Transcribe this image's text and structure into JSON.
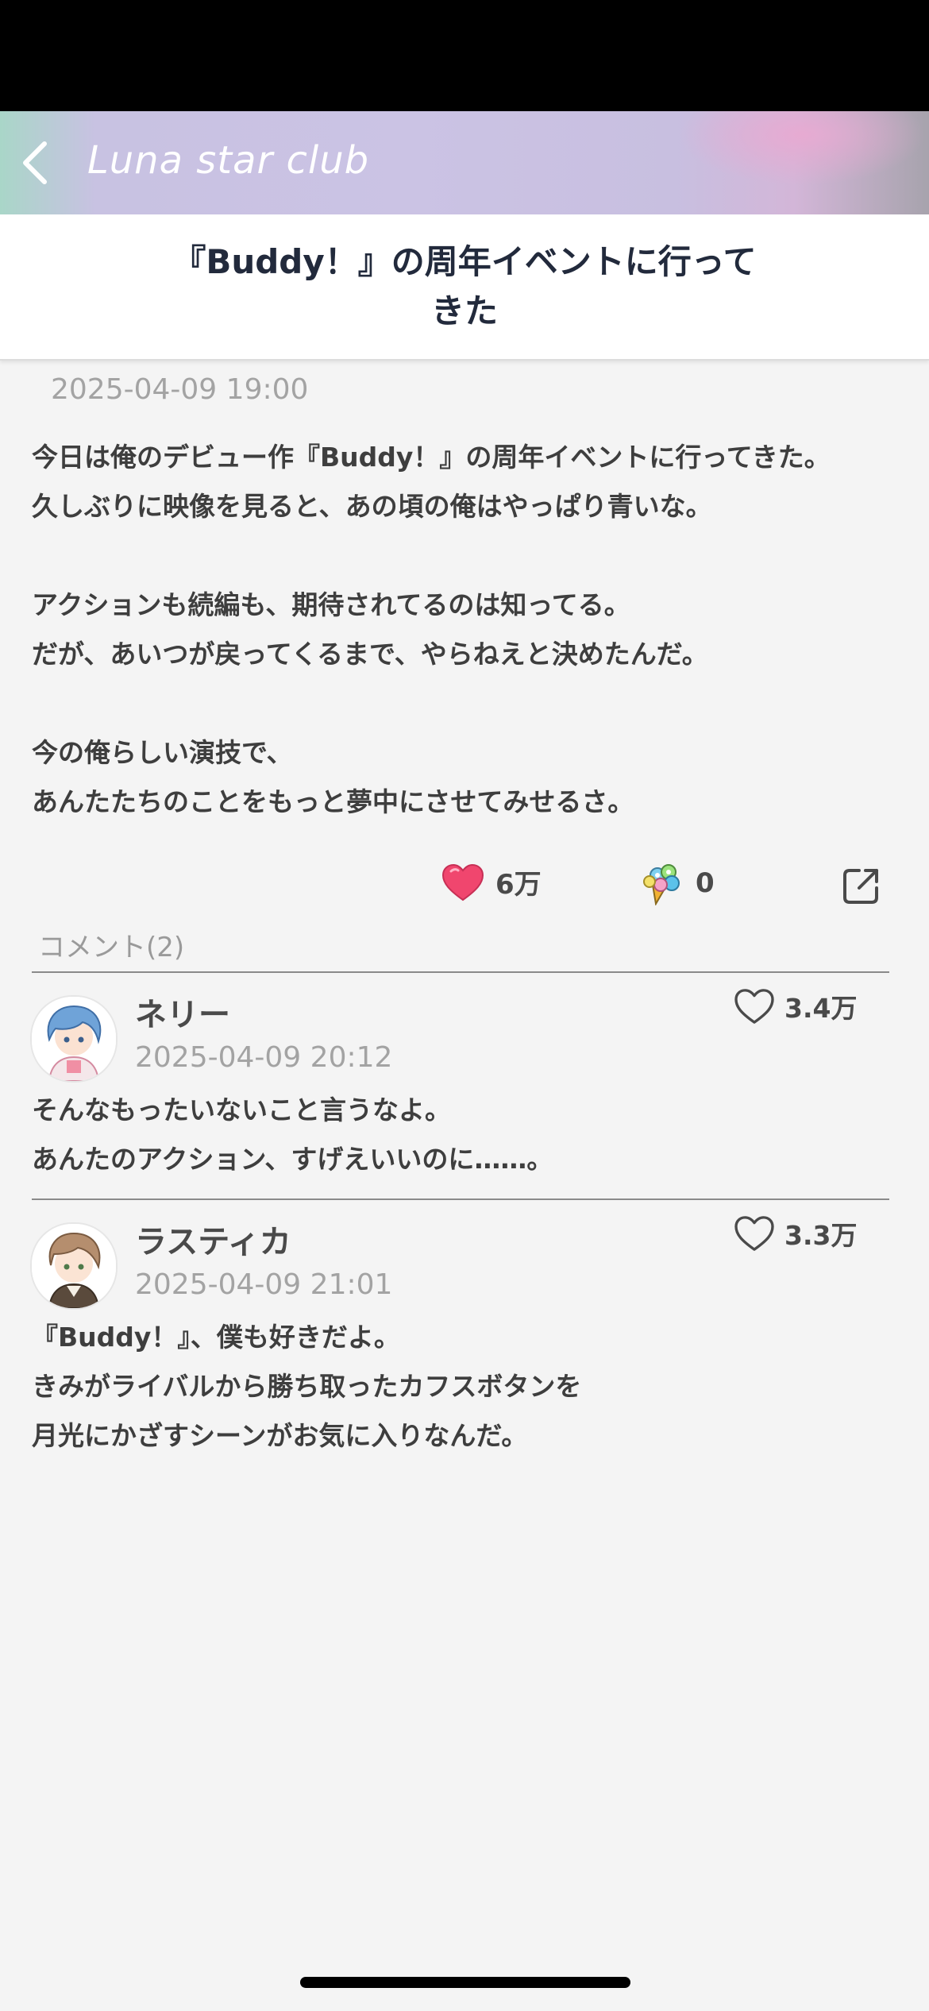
{
  "header": {
    "back_label": "",
    "club_title": "Luna star club"
  },
  "post": {
    "title": "『Buddy！』の周年イベントに行ってきた",
    "date": "2025-04-09 19:00",
    "body_lines": [
      "今日は俺のデビュー作『Buddy！』の周年イベントに行ってきた。",
      "久しぶりに映像を見ると、あの頃の俺はやっぱり青いな。",
      "",
      "アクションも続編も、期待されてるのは知ってる。",
      "だが、あいつが戻ってくるまで、やらねえと決めたんだ。",
      "",
      "今の俺らしい演技で、",
      "あんたたちのことをもっと夢中にさせてみせるさ。"
    ],
    "like_count": "6万",
    "gift_count": "0"
  },
  "comments": {
    "header": "コメント(2)",
    "items": [
      {
        "author": "ネリー",
        "date": "2025-04-09 20:12",
        "like_count": "3.4万",
        "lines": [
          "そんなもったいないこと言うなよ。",
          "あんたのアクション、すげえいいのに……。"
        ]
      },
      {
        "author": "ラスティカ",
        "date": "2025-04-09 21:01",
        "like_count": "3.3万",
        "lines": [
          "『Buddy！』、僕も好きだよ。",
          "きみがライバルから勝ち取ったカフスボタンを",
          "月光にかざすシーンがお気に入りなんだ。"
        ]
      }
    ]
  },
  "colors": {
    "heart_filled": "#f0466e",
    "title_text": "#222a3c",
    "date_text": "#a3a3a3"
  },
  "icons": {
    "back": "chevron-left-icon",
    "like": "heart-filled-icon",
    "gift": "flower-bouquet-icon",
    "share": "share-external-icon",
    "comment_like": "heart-outline-icon"
  }
}
